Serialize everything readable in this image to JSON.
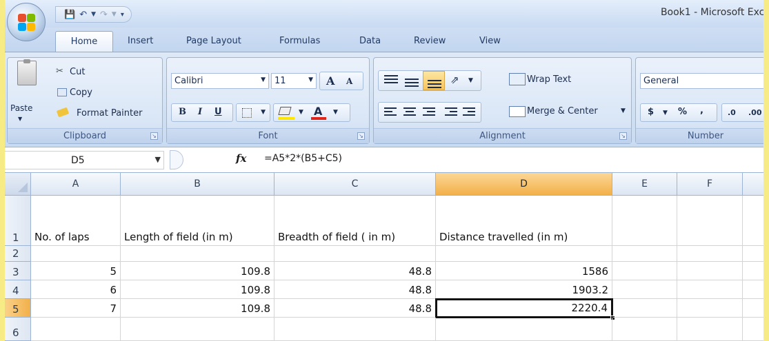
{
  "window": {
    "title": "Book1 - Microsoft Exce"
  },
  "tabs": [
    "Home",
    "Insert",
    "Page Layout",
    "Formulas",
    "Data",
    "Review",
    "View"
  ],
  "clipboard": {
    "paste": "Paste",
    "cut": "Cut",
    "copy": "Copy",
    "format_painter": "Format Painter",
    "label": "Clipboard"
  },
  "font": {
    "name": "Calibri",
    "size": "11",
    "bold": "B",
    "italic": "I",
    "underline": "U",
    "grow": "A",
    "shrink": "A",
    "color_letter": "A",
    "label": "Font"
  },
  "alignment": {
    "wrap": "Wrap Text",
    "merge": "Merge & Center",
    "label": "Alignment"
  },
  "number": {
    "format": "General",
    "currency": "$",
    "percent": "%",
    "comma": ",",
    "inc_dec": ".0",
    "dec_dec": ".00",
    "label": "Number"
  },
  "formula_bar": {
    "name_box": "D5",
    "fx": "fx",
    "formula": "=A5*2*(B5+C5)"
  },
  "columns": [
    "A",
    "B",
    "C",
    "D",
    "E",
    "F"
  ],
  "rows": [
    {
      "num": "1",
      "cells": [
        "No. of laps",
        "Length of field  (in m)",
        "Breadth of field ( in m)",
        "Distance travelled (in m)",
        "",
        ""
      ]
    },
    {
      "num": "2",
      "cells": [
        "",
        "",
        "",
        "",
        "",
        ""
      ]
    },
    {
      "num": "3",
      "cells": [
        "5",
        "109.8",
        "48.8",
        "1586",
        "",
        ""
      ]
    },
    {
      "num": "4",
      "cells": [
        "6",
        "109.8",
        "48.8",
        "1903.2",
        "",
        ""
      ]
    },
    {
      "num": "5",
      "cells": [
        "7",
        "109.8",
        "48.8",
        "2220.4",
        "",
        ""
      ]
    },
    {
      "num": "6",
      "cells": [
        "",
        "",
        "",
        "",
        "",
        ""
      ]
    }
  ],
  "selection": {
    "cell": "D5",
    "column": "D",
    "row": "5"
  },
  "colors": {
    "frame": "#f7eb86",
    "ribbon": "#c9dbf1",
    "selected_header": "#f2b04a"
  }
}
